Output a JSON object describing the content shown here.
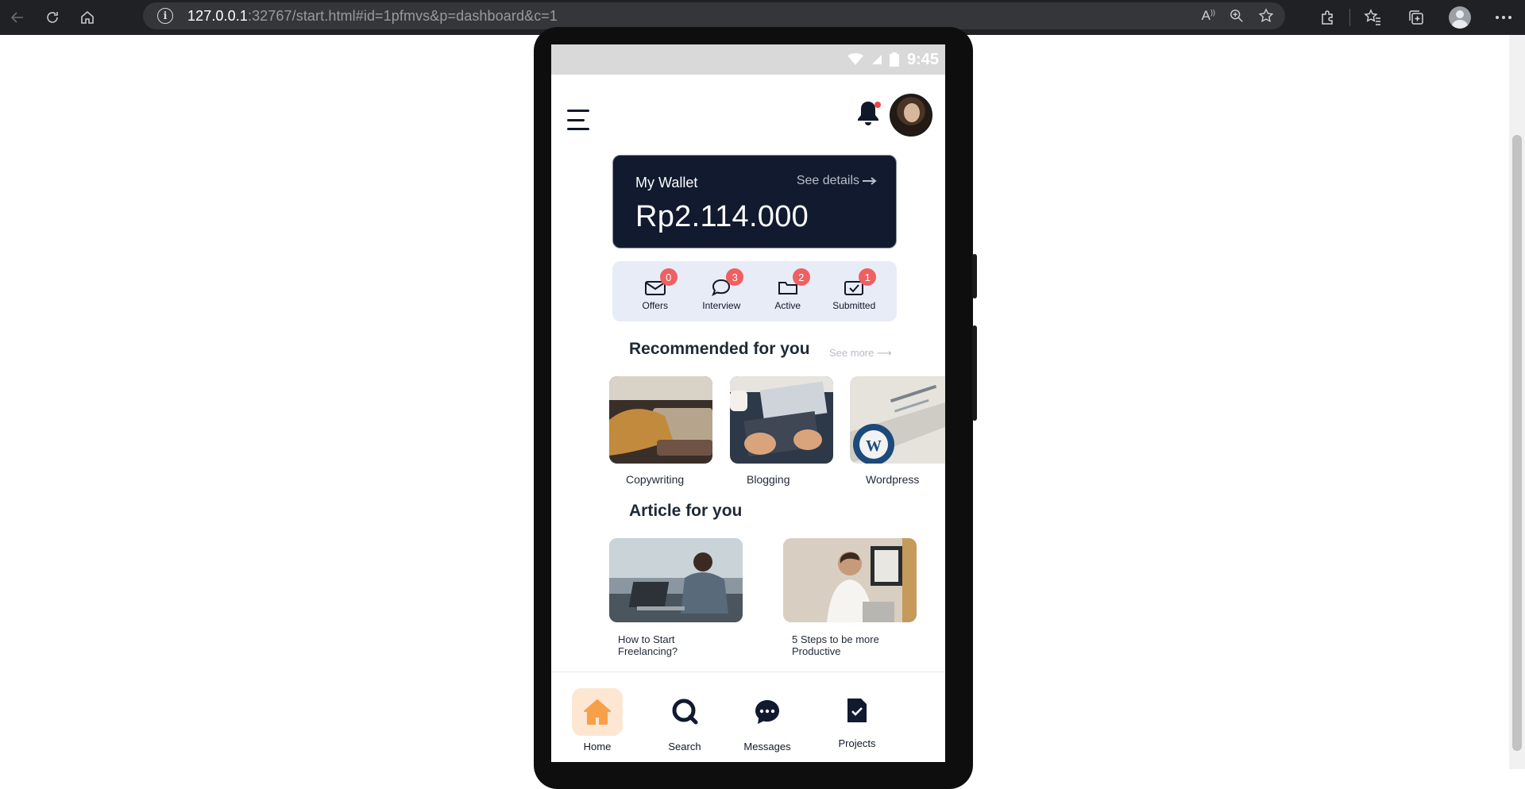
{
  "browser": {
    "url_host": "127.0.0.1",
    "url_rest": ":32767/start.html#id=1pfmvs&p=dashboard&c=1"
  },
  "status_bar": {
    "time": "9:45"
  },
  "wallet": {
    "title": "My Wallet",
    "link_label": "See details",
    "amount": "Rp2.114.000"
  },
  "stats": [
    {
      "label": "Offers",
      "count": "0",
      "icon": "envelope-icon"
    },
    {
      "label": "Interview",
      "count": "3",
      "icon": "chat-bubble-icon"
    },
    {
      "label": "Active",
      "count": "2",
      "icon": "folder-icon"
    },
    {
      "label": "Submitted",
      "count": "1",
      "icon": "check-envelope-icon"
    }
  ],
  "recommended": {
    "title": "Recommended for you",
    "see_more": "See more",
    "items": [
      {
        "label": "Copywriting"
      },
      {
        "label": "Blogging"
      },
      {
        "label": "Wordpress"
      }
    ]
  },
  "articles": {
    "title": "Article for you",
    "items": [
      {
        "label": "How to Start Freelancing?"
      },
      {
        "label": "5 Steps to be more Productive"
      }
    ]
  },
  "nav": {
    "items": [
      {
        "label": "Home",
        "icon": "home-icon",
        "active": true
      },
      {
        "label": "Search",
        "icon": "search-icon",
        "active": false
      },
      {
        "label": "Messages",
        "icon": "messages-icon",
        "active": false
      },
      {
        "label": "Projects",
        "icon": "projects-icon",
        "active": false
      }
    ]
  },
  "colors": {
    "wallet_bg": "#111a2e",
    "accent_orange": "#f6a14a",
    "badge_red": "#ef6060",
    "stats_bg": "#e8ecf7"
  }
}
